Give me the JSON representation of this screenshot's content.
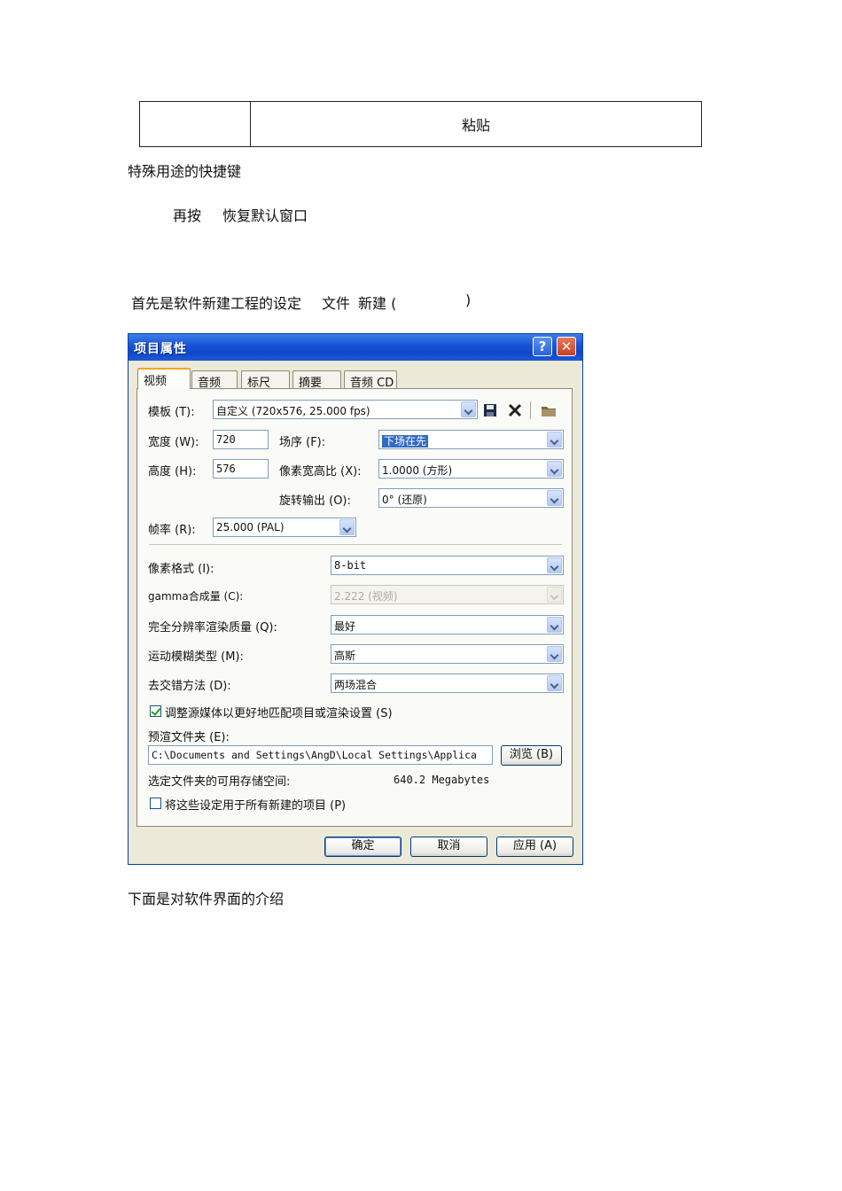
{
  "top_table": {
    "cell1": "",
    "cell2": "粘贴"
  },
  "paragraphs": {
    "p1": "特殊用途的快捷键",
    "p2a": "再按",
    "p2b": "恢复默认窗口",
    "p3": "首先是软件新建工程的设定",
    "p3b": "文件",
    "p3c": "新建 (",
    "p3d": ")",
    "p4": "下面是对软件界面的介绍"
  },
  "dialog": {
    "title": "项目属性",
    "help_glyph": "?",
    "close_glyph": "✕",
    "tabs": [
      "视频",
      "音频",
      "标尺",
      "摘要",
      "音频 CD"
    ],
    "template": {
      "label": "模板 (T):",
      "value": "自定义  (720x576, 25.000 fps)"
    },
    "width": {
      "label": "宽度 (W):",
      "value": "720"
    },
    "height": {
      "label": "高度 (H):",
      "value": "576"
    },
    "field_order": {
      "label": "场序 (F):",
      "value": "下场在先"
    },
    "pixel_aspect": {
      "label": "像素宽高比 (X):",
      "value": "1.0000  (方形)"
    },
    "rotation": {
      "label": "旋转输出 (O):",
      "value": "0°   (还原)"
    },
    "frame_rate": {
      "label": "帧率 (R):",
      "value": "25.000  (PAL)"
    },
    "pixel_format": {
      "label": "像素格式 (I):",
      "value": "8-bit"
    },
    "gamma": {
      "label": "gamma合成量 (C):",
      "value": "2.222  (视频)"
    },
    "render_quality": {
      "label": "完全分辨率渲染质量 (Q):",
      "value": "最好"
    },
    "motion_blur": {
      "label": "运动模糊类型 (M):",
      "value": "高斯"
    },
    "deinterlace": {
      "label": "去交错方法 (D):",
      "value": "两场混合"
    },
    "adjust_media": {
      "label": "调整源媒体以更好地匹配项目或渲染设置 (S)",
      "checked": true
    },
    "prerender": {
      "label": "预渲文件夹 (E):",
      "value": "C:\\Documents and Settings\\AngD\\Local Settings\\Applica",
      "browse": "浏览 (B)"
    },
    "free_space": {
      "label": "选定文件夹的可用存储空间:",
      "value": "640.2 Megabytes"
    },
    "use_for_new": {
      "label": "将这些设定用于所有新建的项目 (P)",
      "checked": false
    },
    "buttons": {
      "ok": "确定",
      "cancel": "取消",
      "apply": "应用 (A)"
    }
  }
}
